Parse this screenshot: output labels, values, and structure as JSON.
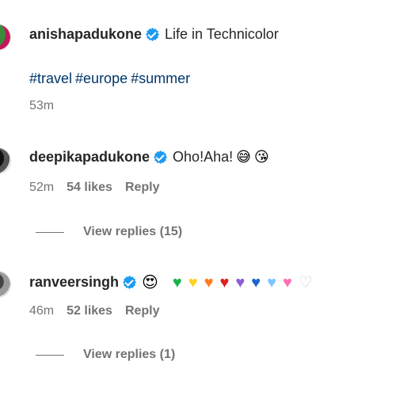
{
  "posts": [
    {
      "username": "anishapadukone",
      "caption": "Life in Technicolor",
      "hashtags": [
        "#travel",
        "#europe",
        "#summer"
      ],
      "time": "53m"
    }
  ],
  "comments": [
    {
      "username": "deepikapadukone",
      "text": "Oho!Aha!",
      "emojis": [
        "😅",
        "😘"
      ],
      "time": "52m",
      "likes": "54 likes",
      "reply": "Reply",
      "view_replies": "View replies (15)"
    },
    {
      "username": "ranveersingh",
      "emojis": [
        "😍"
      ],
      "hearts": [
        {
          "glyph": "♥",
          "color": "#19b34c"
        },
        {
          "glyph": "♥",
          "color": "#ffd21f"
        },
        {
          "glyph": "♥",
          "color": "#ff7a1a"
        },
        {
          "glyph": "♥",
          "color": "#e01e1e"
        },
        {
          "glyph": "♥",
          "color": "#8e5bd9"
        },
        {
          "glyph": "♥",
          "color": "#1c66c9"
        },
        {
          "glyph": "♥",
          "color": "#7fc4ff"
        },
        {
          "glyph": "♥",
          "color": "#ff6fb5"
        },
        {
          "glyph": "♡",
          "color": "#cfcfcf"
        }
      ],
      "time": "46m",
      "likes": "52 likes",
      "reply": "Reply",
      "view_replies": "View replies (1)"
    }
  ],
  "colors": {
    "link": "#00376b",
    "meta": "#737373",
    "verified": "#1d9bf0"
  }
}
